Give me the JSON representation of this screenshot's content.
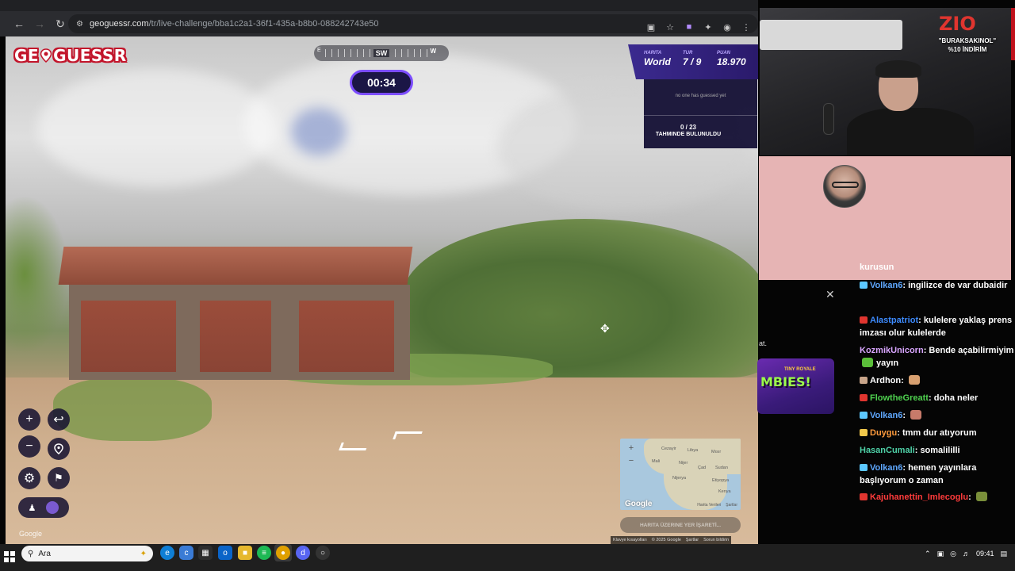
{
  "browser": {
    "url_host": "geoguessr.com",
    "url_path": "/tr/live-challenge/bba1c2a1-36f1-435a-b8b0-088242743e50"
  },
  "game": {
    "logo_text_left": "GE",
    "logo_text_right": "GUESSR",
    "compass_heading": "SW",
    "compass_w": "W",
    "compass_e": "E",
    "timer": "00:34",
    "stats": [
      {
        "label": "HARITA",
        "value": "World"
      },
      {
        "label": "TUR",
        "value": "7 / 9"
      },
      {
        "label": "PUAN",
        "value": "18.970"
      }
    ],
    "guess_empty": "no one has guessed yet",
    "guess_count": "0 / 23",
    "guess_label": "TAHMINDE BULUNULDU",
    "place_button": "HARITA ÜZERINE YER İŞARETİ...",
    "google_watermark": "Google"
  },
  "minimap": {
    "labels": [
      "Cezayir",
      "Libya",
      "Mısır",
      "Mali",
      "Nijer",
      "Çad",
      "Sudan",
      "Nijerya",
      "Etiyopya",
      "Kenya"
    ],
    "google": "Google",
    "footer": [
      "Harita Verileri",
      "Şartlar"
    ]
  },
  "footer_links": [
    "Klavye kısayolları",
    "© 2025 Google",
    "Şartlar",
    "Sorun bildirin"
  ],
  "sponsor": {
    "logo": "ZIO",
    "line1": "\"BURAKSAKINOL\"",
    "line2": "%10 İNDİRİM"
  },
  "chat": {
    "partial_top": "kurusun",
    "messages": [
      {
        "user": "Volkan6",
        "color": "#5fa8ff",
        "badge": "#5cc8ff",
        "text": "ingilizce de var dubaidir",
        "emote": ""
      },
      {
        "user": "Alastpatriot",
        "color": "#3d8bff",
        "badge": "#e0352f",
        "text": "kulelere yaklaş prens imzası olur kulelerde",
        "emote": ""
      },
      {
        "user": "KozmikUnicorn",
        "color": "#d9a6ff",
        "badge": "",
        "text": "Bende açabilirmiyim",
        "emote": "#5bbf3a",
        "after": "yayın"
      },
      {
        "user": "Ardhon",
        "color": "#ffffff",
        "badge": "#c9a58a",
        "text": "",
        "emote": "#d8a070"
      },
      {
        "user": "FlowtheGreatt",
        "color": "#4fd24f",
        "badge": "#e0352f",
        "text": "doha neler",
        "emote": ""
      },
      {
        "user": "Volkan6",
        "color": "#5fa8ff",
        "badge": "#5cc8ff",
        "text": "",
        "emote": "#c77a6a"
      },
      {
        "user": "Duygu",
        "color": "#ff9b3d",
        "badge": "#f2c94c",
        "text": "tmm dur atıyorum",
        "emote": ""
      },
      {
        "user": "HasanCumali",
        "color": "#4fd2a8",
        "badge": "",
        "text": "somalililli",
        "emote": ""
      },
      {
        "user": "Volkan6",
        "color": "#5fa8ff",
        "badge": "#5cc8ff",
        "text": "hemen yayınlara başlıyorum o zaman",
        "emote": ""
      },
      {
        "user": "Kajuhanettin_Imlecoglu",
        "color": "#ff3b3b",
        "badge": "#e0352f",
        "text": "",
        "emote": "#7a8f3a"
      }
    ]
  },
  "side_panel": {
    "at_text": "at.",
    "zombie_sub": "TINY ROYALE",
    "zombie_title": "MBIES!"
  },
  "taskbar": {
    "search_placeholder": "Ara",
    "clock": "09:41"
  }
}
